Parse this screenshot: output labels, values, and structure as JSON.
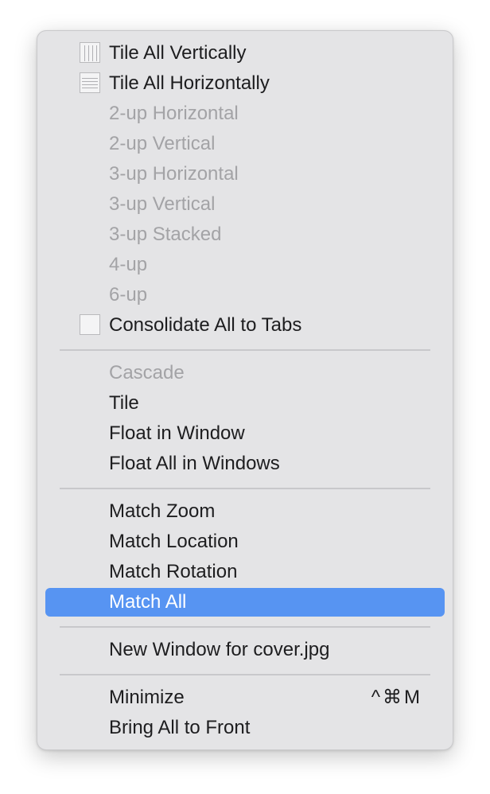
{
  "menu": {
    "items": [
      {
        "label": "Tile All Vertically",
        "icon": "tile-vertical-icon",
        "enabled": true
      },
      {
        "label": "Tile All Horizontally",
        "icon": "tile-horizontal-icon",
        "enabled": true
      },
      {
        "label": "2-up Horizontal",
        "enabled": false
      },
      {
        "label": "2-up Vertical",
        "enabled": false
      },
      {
        "label": "3-up Horizontal",
        "enabled": false
      },
      {
        "label": "3-up Vertical",
        "enabled": false
      },
      {
        "label": "3-up Stacked",
        "enabled": false
      },
      {
        "label": "4-up",
        "enabled": false
      },
      {
        "label": "6-up",
        "enabled": false
      },
      {
        "label": "Consolidate All to Tabs",
        "icon": "consolidate-tabs-icon",
        "enabled": true
      },
      {
        "label": "Cascade",
        "enabled": false
      },
      {
        "label": "Tile",
        "enabled": true
      },
      {
        "label": "Float in Window",
        "enabled": true
      },
      {
        "label": "Float All in Windows",
        "enabled": true
      },
      {
        "label": "Match Zoom",
        "enabled": true
      },
      {
        "label": "Match Location",
        "enabled": true
      },
      {
        "label": "Match Rotation",
        "enabled": true
      },
      {
        "label": "Match All",
        "enabled": true,
        "highlighted": true
      },
      {
        "label": "New Window for cover.jpg",
        "enabled": true
      },
      {
        "label": "Minimize",
        "enabled": true,
        "shortcut": "^⌘M"
      },
      {
        "label": "Bring All to Front",
        "enabled": true
      }
    ]
  },
  "colors": {
    "highlight": "#5794f2",
    "menu_background": "#e4e4e6",
    "disabled_text": "#a3a3a6"
  }
}
